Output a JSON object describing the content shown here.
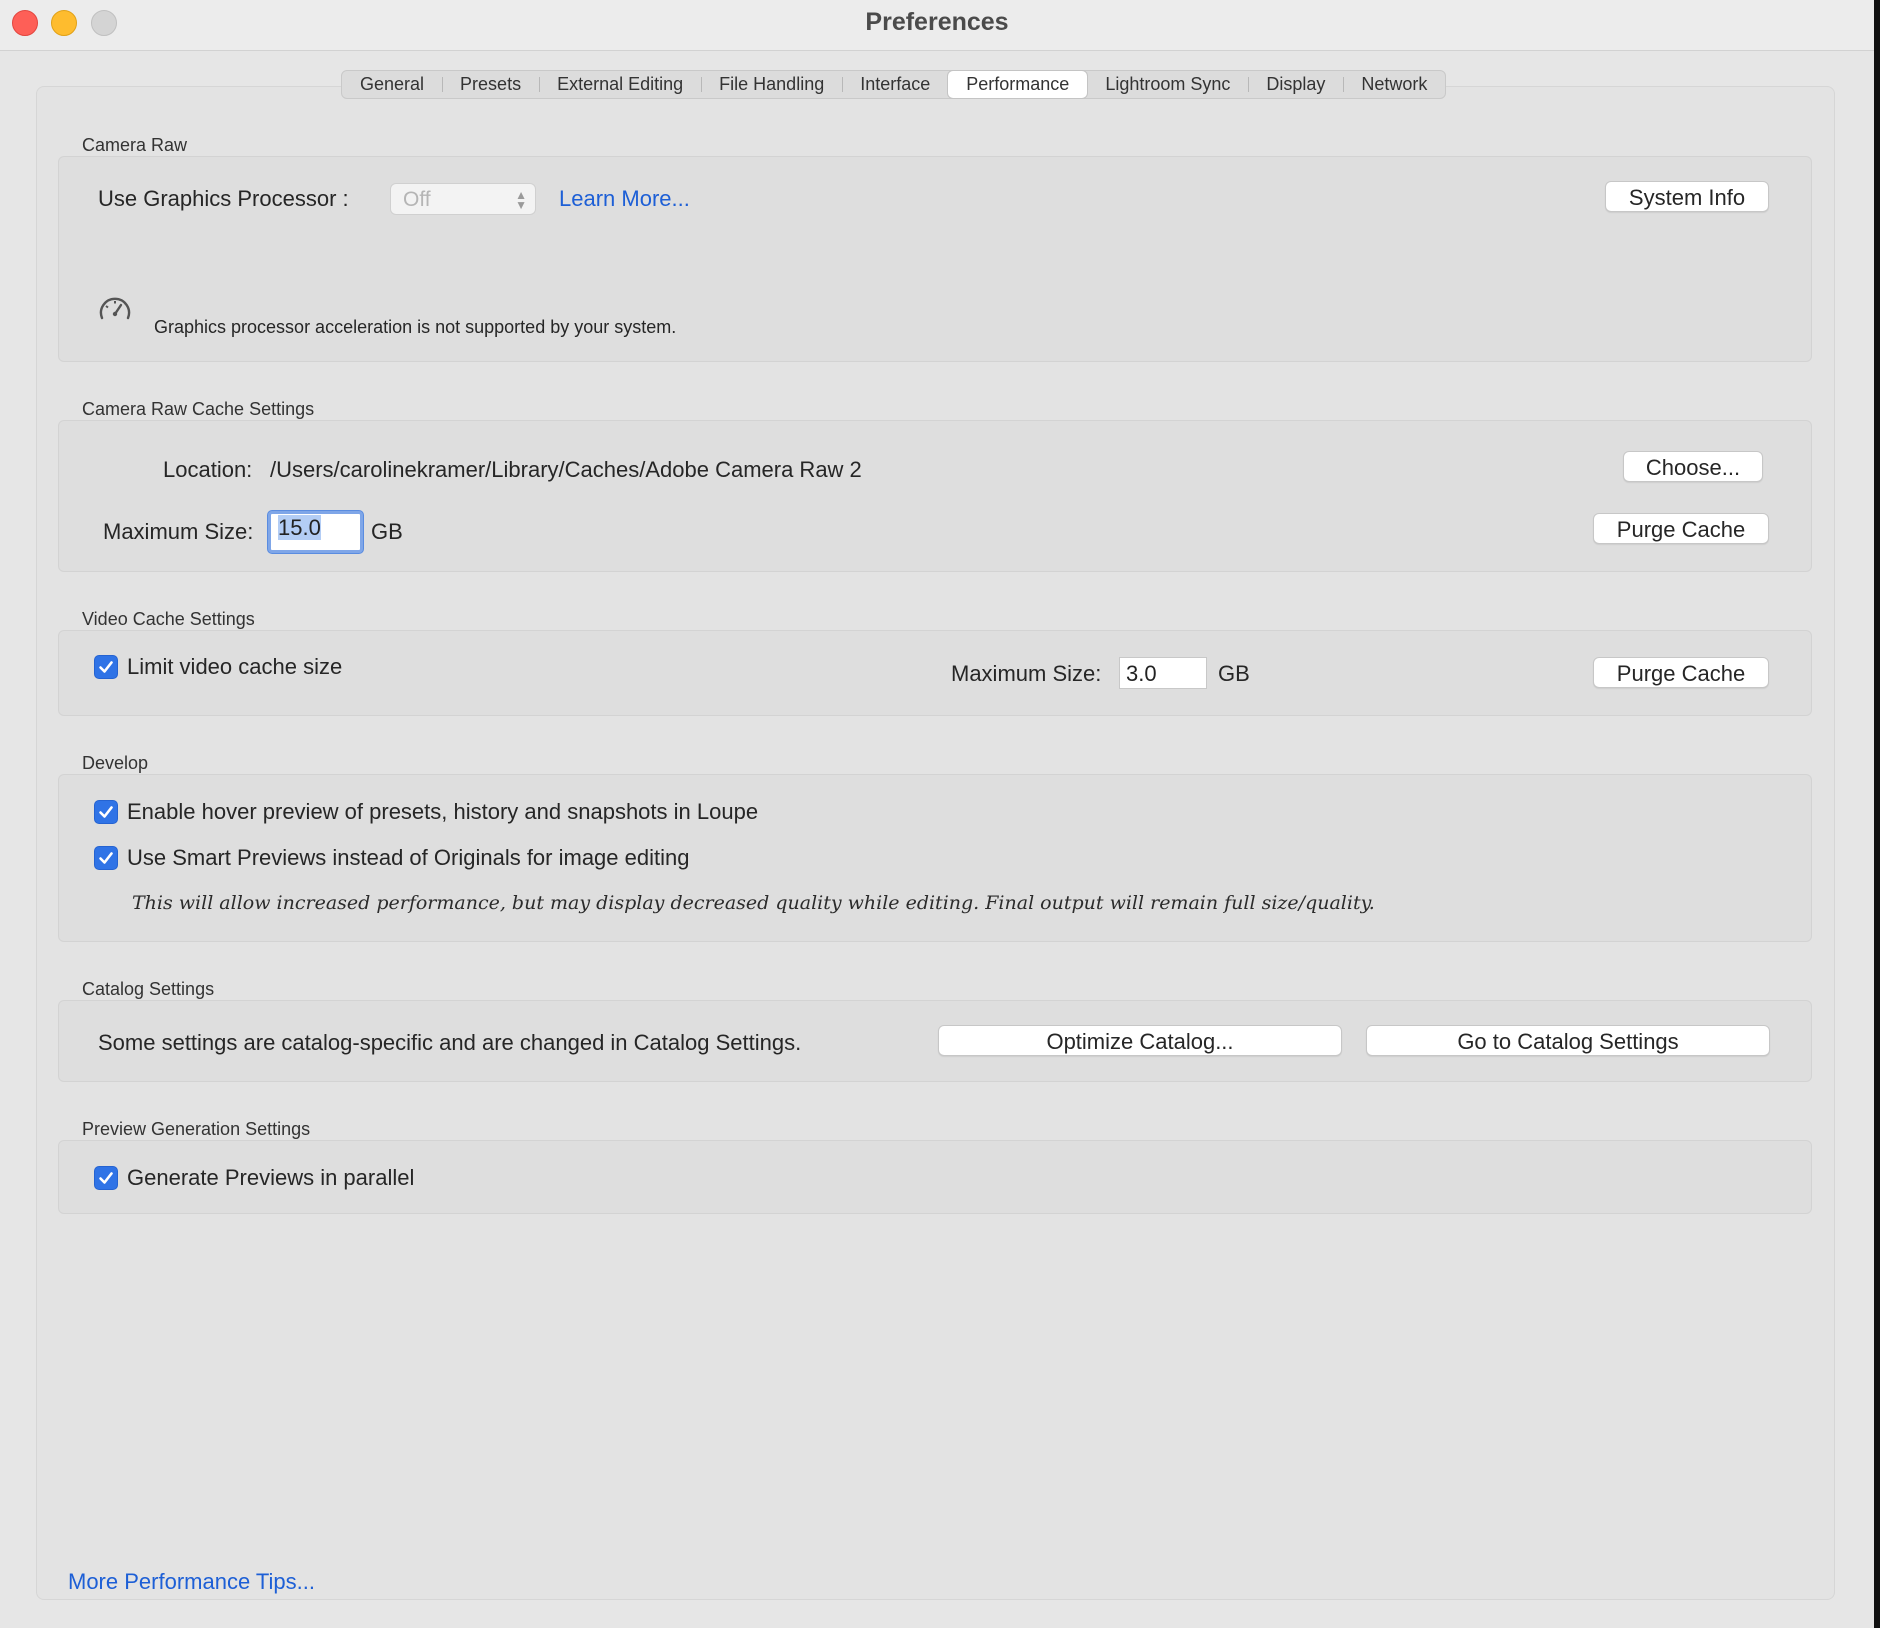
{
  "window": {
    "title": "Preferences"
  },
  "tabs": [
    {
      "label": "General"
    },
    {
      "label": "Presets"
    },
    {
      "label": "External Editing"
    },
    {
      "label": "File Handling"
    },
    {
      "label": "Interface"
    },
    {
      "label": "Performance",
      "active": true
    },
    {
      "label": "Lightroom Sync"
    },
    {
      "label": "Display"
    },
    {
      "label": "Network"
    }
  ],
  "camera_raw": {
    "title": "Camera Raw",
    "gpu_label": "Use Graphics Processor :",
    "gpu_value": "Off",
    "learn_more": "Learn More...",
    "system_info": "System Info",
    "gauge_icon": "gauge-icon",
    "message": "Graphics processor acceleration is not supported by your system."
  },
  "cache": {
    "title": "Camera Raw Cache Settings",
    "location_label": "Location:",
    "location_value": "/Users/carolinekramer/Library/Caches/Adobe Camera Raw 2",
    "choose": "Choose...",
    "max_label": "Maximum Size:",
    "max_value": "15.0",
    "unit": "GB",
    "purge": "Purge Cache"
  },
  "video": {
    "title": "Video Cache Settings",
    "limit_label": "Limit video cache size",
    "limit_checked": true,
    "max_label": "Maximum Size:",
    "max_value": "3.0",
    "unit": "GB",
    "purge": "Purge Cache"
  },
  "develop": {
    "title": "Develop",
    "hover_label": "Enable hover preview of presets, history and snapshots in Loupe",
    "smart_label": "Use Smart Previews instead of Originals for image editing",
    "note": "This will allow increased performance, but may display decreased quality while editing. Final output will remain full size/quality."
  },
  "catalog": {
    "title": "Catalog Settings",
    "text": "Some settings are catalog-specific and are changed in Catalog Settings.",
    "optimize": "Optimize Catalog...",
    "goto": "Go to Catalog Settings"
  },
  "preview": {
    "title": "Preview Generation Settings",
    "parallel_label": "Generate Previews in parallel"
  },
  "footer": {
    "tips_link": "More Performance Tips..."
  },
  "colors": {
    "accent": "#2f73e6",
    "link": "#1d5fd6",
    "close": "#fe5f57",
    "minimize": "#febc2e"
  }
}
